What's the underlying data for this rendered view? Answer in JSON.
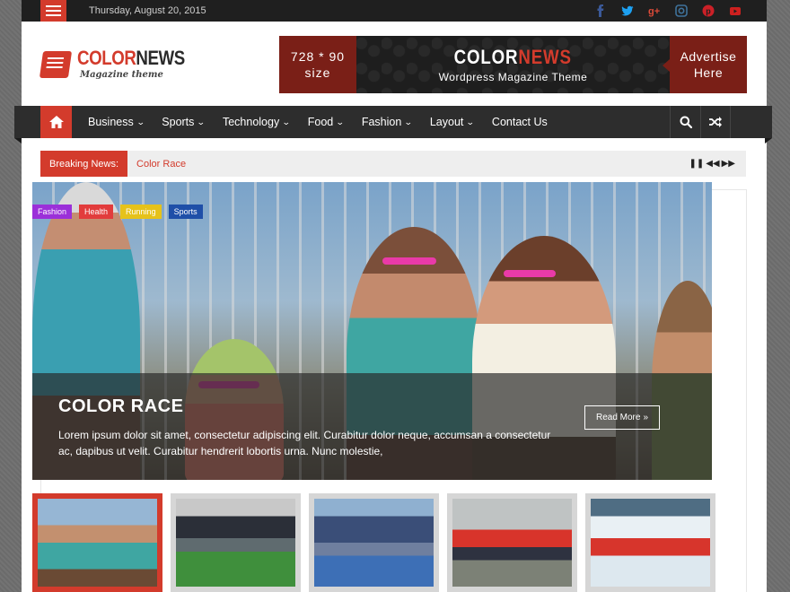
{
  "topbar": {
    "date": "Thursday, August 20, 2015",
    "socials": [
      "facebook-icon",
      "twitter-icon",
      "googleplus-icon",
      "instagram-icon",
      "pinterest-icon",
      "youtube-icon"
    ]
  },
  "header": {
    "logo_part1": "COLOR",
    "logo_part2": "NEWS",
    "logo_tagline": "Magazine theme",
    "ad": {
      "size_line1": "728 * 90",
      "size_line2": "size",
      "brand_part1": "COLOR",
      "brand_part2": "NEWS",
      "subtitle": "Wordpress Magazine Theme",
      "cta_line1": "Advertise",
      "cta_line2": "Here"
    }
  },
  "nav": {
    "items": [
      {
        "label": "Business",
        "has_dropdown": true
      },
      {
        "label": "Sports",
        "has_dropdown": true
      },
      {
        "label": "Technology",
        "has_dropdown": true
      },
      {
        "label": "Food",
        "has_dropdown": true
      },
      {
        "label": "Fashion",
        "has_dropdown": true
      },
      {
        "label": "Layout",
        "has_dropdown": true
      },
      {
        "label": "Contact Us",
        "has_dropdown": false
      }
    ]
  },
  "breaking": {
    "label": "Breaking News:",
    "headline": "Color Race"
  },
  "featured": {
    "categories": [
      {
        "label": "Fashion",
        "color": "#9b30d9"
      },
      {
        "label": "Health",
        "color": "#e23c3c"
      },
      {
        "label": "Running",
        "color": "#e6c21a"
      },
      {
        "label": "Sports",
        "color": "#1f4fa8"
      }
    ],
    "title": "COLOR RACE",
    "excerpt": "Lorem ipsum dolor sit amet, consectetur adipiscing elit. Curabitur dolor neque, accumsan a consectetur ac, dapibus ut velit. Curabitur hendrerit lobortis urna. Nunc molestie,",
    "read_more": "Read More"
  },
  "colors": {
    "accent": "#d33b2c",
    "topbar_bg": "#1f1f1f",
    "nav_bg": "#2d2d2d"
  }
}
